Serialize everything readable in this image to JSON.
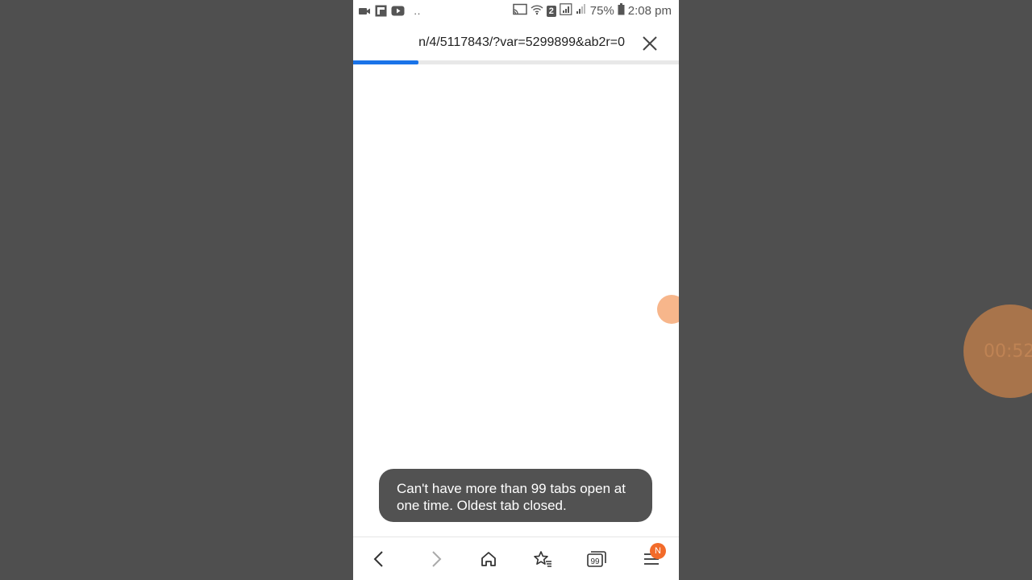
{
  "status_bar": {
    "battery": "75%",
    "time": "2:08 pm",
    "sim": "2",
    "dots": "··"
  },
  "url_bar": {
    "url": "n/4/5117843/?var=5299899&ab2r=0",
    "progress": 0.2
  },
  "toast": {
    "message": "Can't have more than 99 tabs open at one time. Oldest tab closed."
  },
  "nav_bar": {
    "tabs_count": "99",
    "menu_badge": "N"
  },
  "background": {
    "timer_text": "00:52"
  },
  "colors": {
    "accent": "#1a73e8",
    "badge": "#f26b2a",
    "toast_bg": "#525252"
  }
}
